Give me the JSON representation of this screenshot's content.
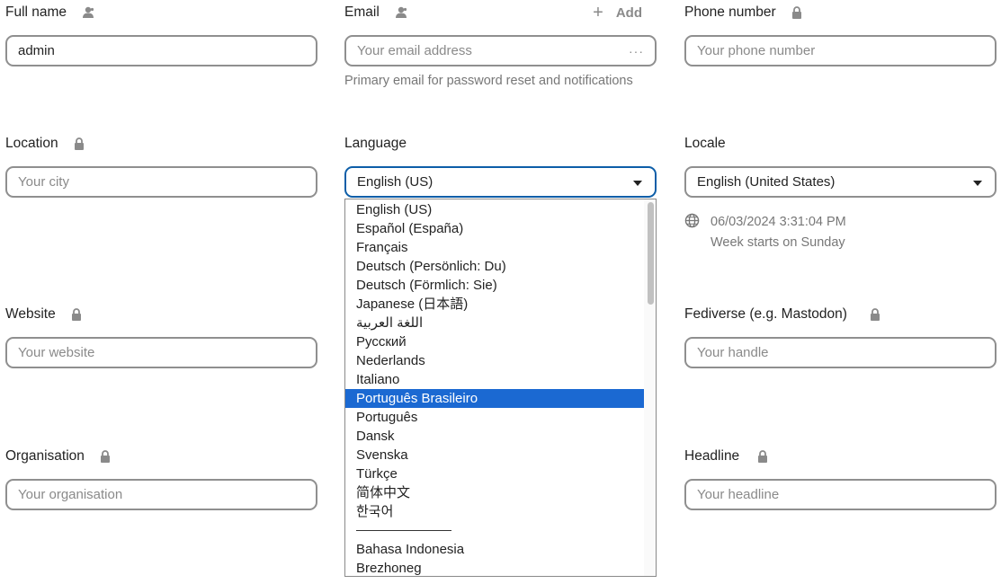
{
  "fields": {
    "full_name": {
      "label": "Full name",
      "value": "admin"
    },
    "email": {
      "label": "Email",
      "add_label": "Add",
      "placeholder": "Your email address",
      "more": "···",
      "helper": "Primary email for password reset and notifications"
    },
    "phone": {
      "label": "Phone number",
      "placeholder": "Your phone number"
    },
    "location": {
      "label": "Location",
      "placeholder": "Your city"
    },
    "language": {
      "label": "Language",
      "value": "English (US)"
    },
    "locale": {
      "label": "Locale",
      "value": "English (United States)",
      "datetime": "06/03/2024 3:31:04 PM",
      "week_start": "Week starts on Sunday"
    },
    "website": {
      "label": "Website",
      "placeholder": "Your website"
    },
    "fediverse": {
      "label": "Fediverse (e.g. Mastodon)",
      "placeholder": "Your handle"
    },
    "organisation": {
      "label": "Organisation",
      "placeholder": "Your organisation"
    },
    "headline": {
      "label": "Headline",
      "placeholder": "Your headline"
    }
  },
  "language_dropdown": {
    "options": [
      "English (US)",
      "Español (España)",
      "Français",
      "Deutsch (Persönlich: Du)",
      "Deutsch (Förmlich: Sie)",
      "Japanese (日本語)",
      "اللغة العربية",
      "Русский",
      "Nederlands",
      "Italiano",
      "Português Brasileiro",
      "Português",
      "Dansk",
      "Svenska",
      "Türkçe",
      "简体中文",
      "한국어",
      "",
      "Bahasa Indonesia",
      "Brezhoneg"
    ],
    "highlighted_index": 10,
    "separator_index": 17
  },
  "icons": {
    "user": "user-scope-icon",
    "lock": "lock-icon",
    "plus": "plus-icon",
    "globe": "globe-icon",
    "caret": "caret-down-icon"
  },
  "colors": {
    "focus_border": "#0d5ea8",
    "selection": "#1b69d2",
    "border": "#8f8f8f",
    "muted_text": "#777777"
  }
}
